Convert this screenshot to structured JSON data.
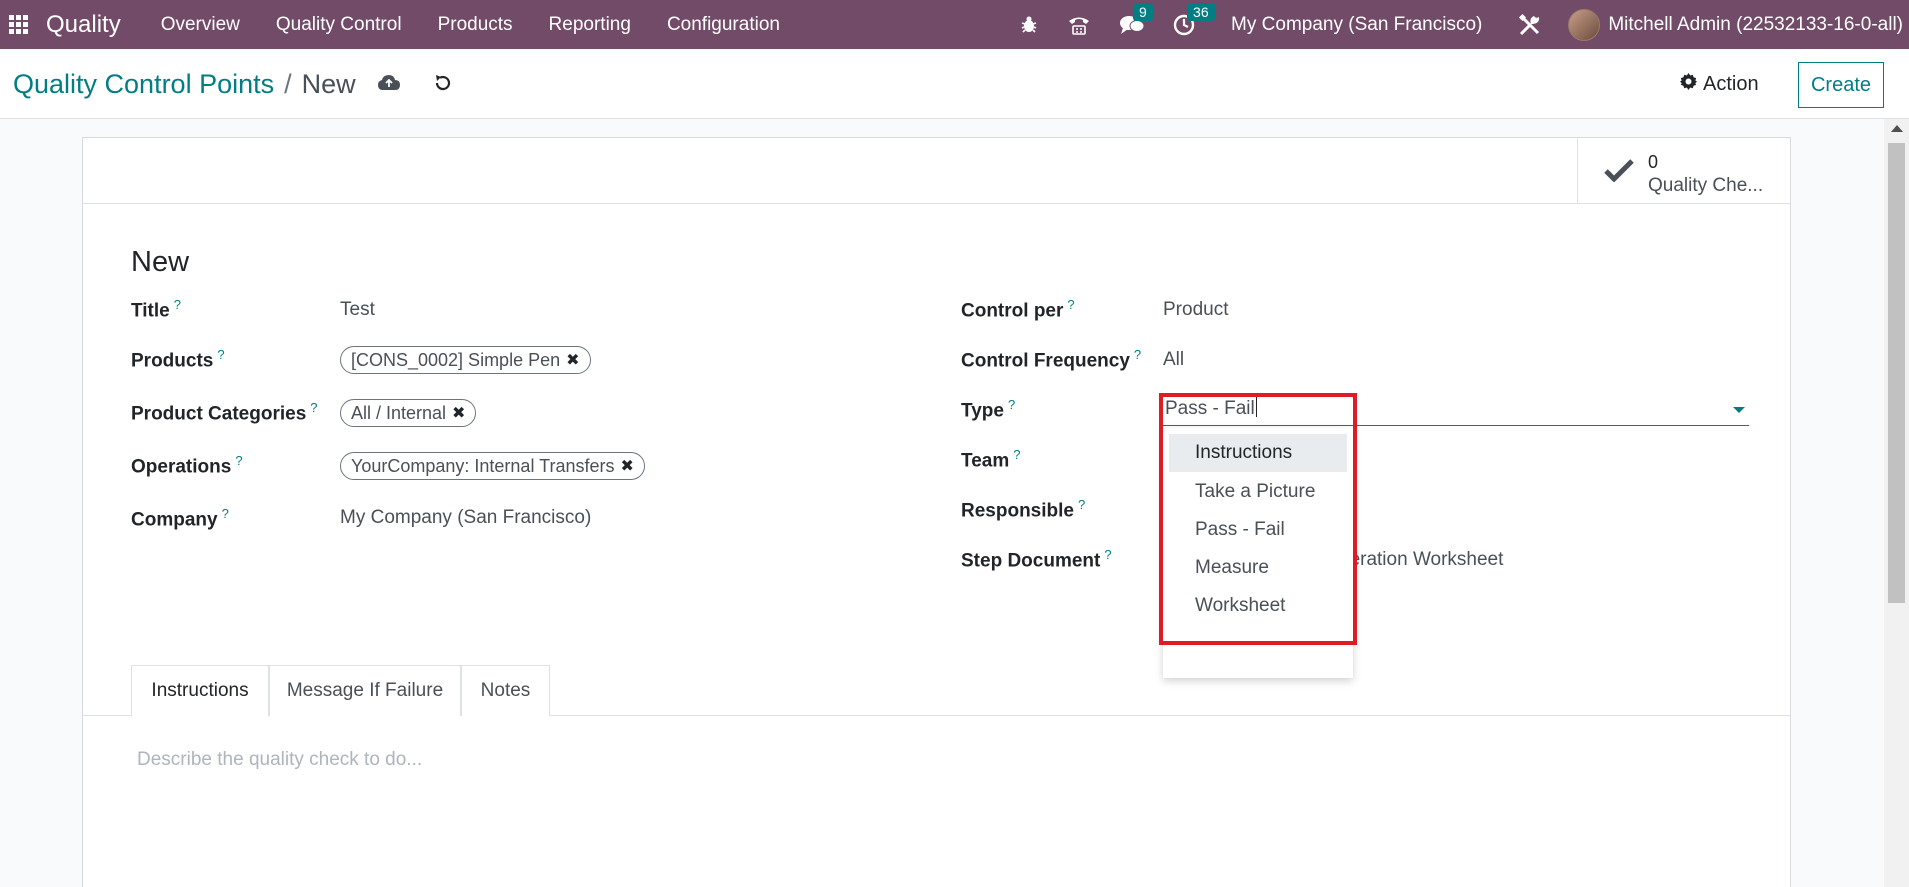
{
  "navbar": {
    "app_name": "Quality",
    "menu": [
      "Overview",
      "Quality Control",
      "Products",
      "Reporting",
      "Configuration"
    ],
    "messages_count": "9",
    "activities_count": "36",
    "company": "My Company (San Francisco)",
    "user": "Mitchell Admin (22532133-16-0-all)"
  },
  "control_panel": {
    "breadcrumb_parent": "Quality Control Points",
    "breadcrumb_separator": "/",
    "breadcrumb_current": "New",
    "action_label": "Action",
    "create_label": "Create"
  },
  "stat_button": {
    "value": "0",
    "label": "Quality Che..."
  },
  "form": {
    "record_title": "New",
    "left": {
      "title_label": "Title",
      "title_value": "Test",
      "products_label": "Products",
      "products_tag": "[CONS_0002] Simple Pen",
      "categories_label": "Product Categories",
      "categories_tag": "All / Internal",
      "operations_label": "Operations",
      "operations_tag": "YourCompany: Internal Transfers",
      "company_label": "Company",
      "company_value": "My Company (San Francisco)"
    },
    "right": {
      "control_per_label": "Control per",
      "control_per_value": "Product",
      "frequency_label": "Control Frequency",
      "frequency_value": "All",
      "type_label": "Type",
      "type_value": "Pass - Fail",
      "team_label": "Team",
      "responsible_label": "Responsible",
      "step_document_label": "Step Document",
      "step_document_value": "peration Worksheet"
    },
    "help_mark": "?"
  },
  "type_dropdown": {
    "options": [
      "Instructions",
      "Take a Picture",
      "Pass - Fail",
      "Measure",
      "Worksheet"
    ],
    "highlighted_index": 0
  },
  "notebook": {
    "tabs": [
      "Instructions",
      "Message If Failure",
      "Notes"
    ],
    "active_tab": 0,
    "placeholder": "Describe the quality check to do..."
  },
  "colors": {
    "navbar": "#714b67",
    "accent": "#017e84",
    "highlight_box": "#e01b24"
  }
}
